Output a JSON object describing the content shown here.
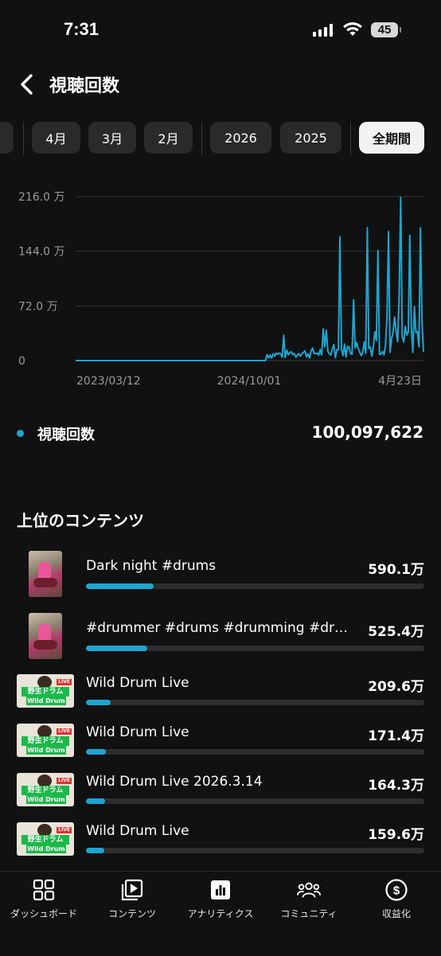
{
  "status_bar": {
    "time": "7:31",
    "battery": "45"
  },
  "header": {
    "title": "視聴回数"
  },
  "filters": {
    "chips": [
      {
        "label": ""
      },
      {
        "label": "4月"
      },
      {
        "label": "3月"
      },
      {
        "label": "2月"
      },
      {
        "label": "2026"
      },
      {
        "label": "2025"
      },
      {
        "label": "全期間",
        "active": true
      }
    ]
  },
  "chart_data": {
    "type": "line",
    "title": "",
    "xlabel": "",
    "ylabel": "",
    "y_ticks": [
      "216.0 万",
      "144.0 万",
      "72.0 万",
      "0"
    ],
    "x_ticks": [
      "2023/03/12",
      "2024/10/01",
      "4月23日"
    ],
    "ylim": [
      0,
      2160000
    ],
    "grid": true,
    "series": [
      {
        "name": "視聴回数",
        "color": "#1ea5d0",
        "x": [
          "2023/03/12",
          "2024/10/01",
          "2024/12/01",
          "2025/01/01",
          "2025/03/01",
          "2025/05/01",
          "2025/06/01",
          "2025/07/01",
          "2025/08/01",
          "2025/09/01",
          "2025/10/01",
          "2025/11/01",
          "2025/12/01",
          "2026/01/01",
          "2026/02/01",
          "2026/03/01",
          "2026/04/01",
          "2026/04/23"
        ],
        "values": [
          0,
          0,
          150000,
          160000,
          120000,
          200000,
          400000,
          1630000,
          800000,
          450000,
          500000,
          1750000,
          1450000,
          900000,
          1700000,
          2150000,
          1650000,
          1750000
        ]
      }
    ]
  },
  "summary": {
    "legend_label": "視聴回数",
    "total": "100,097,622"
  },
  "top_contents": {
    "title": "上位のコンテンツ",
    "items": [
      {
        "title": "Dark night #drums",
        "value": "590.1万",
        "ratio": 0.2,
        "thumb": "portrait"
      },
      {
        "title": "#drummer #drums #drumming #drum...",
        "value": "525.4万",
        "ratio": 0.18,
        "thumb": "portrait"
      },
      {
        "title": "Wild Drum Live",
        "value": "209.6万",
        "ratio": 0.072,
        "thumb": "landscape"
      },
      {
        "title": "Wild Drum Live",
        "value": "171.4万",
        "ratio": 0.058,
        "thumb": "landscape"
      },
      {
        "title": "Wild Drum Live 2026.3.14",
        "value": "164.3万",
        "ratio": 0.056,
        "thumb": "landscape"
      },
      {
        "title": "Wild Drum Live",
        "value": "159.6万",
        "ratio": 0.054,
        "thumb": "landscape"
      }
    ],
    "thumb_text": {
      "line1": "野生ドラム",
      "line2": "Wild Drum",
      "badge": "LIVE"
    }
  },
  "bottom_nav": {
    "items": [
      {
        "label": "ダッシュボード",
        "icon": "dashboard-icon"
      },
      {
        "label": "コンテンツ",
        "icon": "content-icon"
      },
      {
        "label": "アナリティクス",
        "icon": "analytics-icon",
        "active": true
      },
      {
        "label": "コミュニティ",
        "icon": "community-icon"
      },
      {
        "label": "収益化",
        "icon": "monetization-icon"
      }
    ]
  }
}
